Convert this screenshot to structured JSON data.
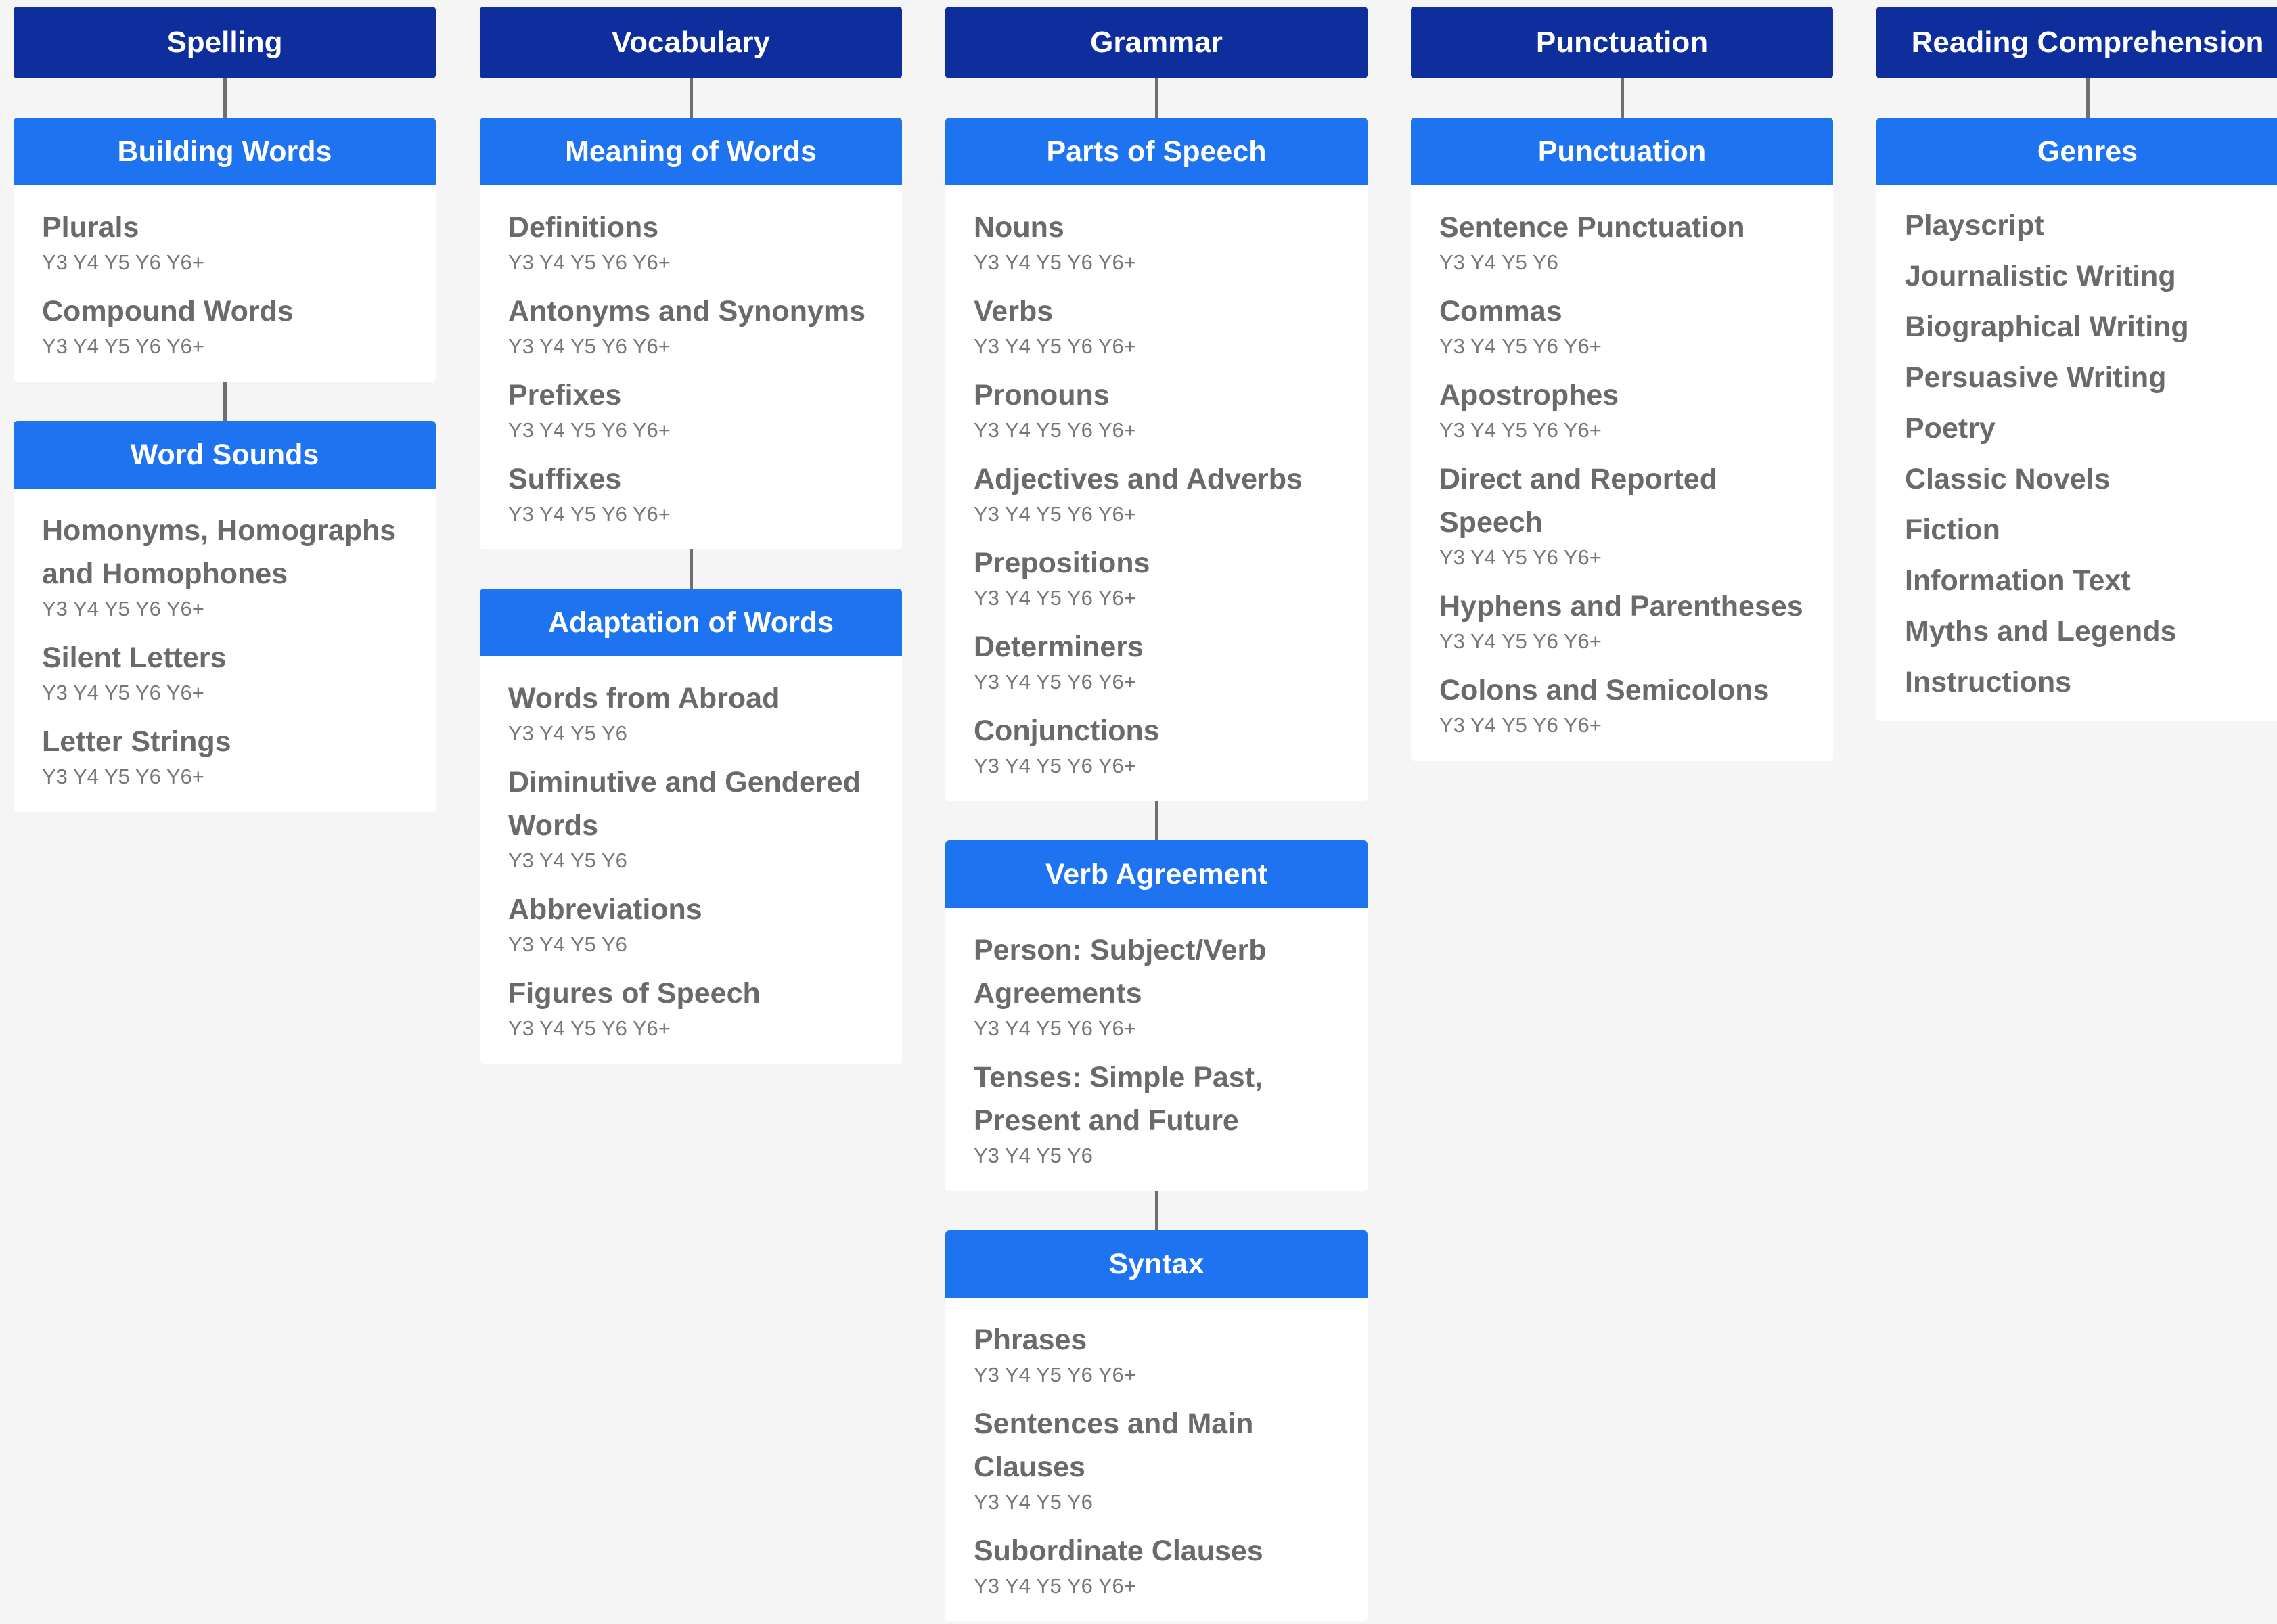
{
  "columns": [
    {
      "category": "Spelling",
      "groups": [
        {
          "title": "Building Words",
          "topics": [
            {
              "name": "Plurals",
              "years": "Y3 Y4 Y5 Y6 Y6+"
            },
            {
              "name": "Compound Words",
              "years": "Y3 Y4 Y5 Y6 Y6+"
            }
          ]
        },
        {
          "title": "Word Sounds",
          "topics": [
            {
              "name": "Homonyms, Homographs and Homophones",
              "years": "Y3 Y4 Y5 Y6 Y6+"
            },
            {
              "name": "Silent Letters",
              "years": "Y3 Y4 Y5 Y6 Y6+"
            },
            {
              "name": "Letter Strings",
              "years": "Y3 Y4 Y5 Y6 Y6+"
            }
          ]
        }
      ]
    },
    {
      "category": "Vocabulary",
      "groups": [
        {
          "title": "Meaning of Words",
          "topics": [
            {
              "name": "Definitions",
              "years": "Y3 Y4 Y5 Y6 Y6+"
            },
            {
              "name": "Antonyms and Synonyms",
              "years": "Y3 Y4 Y5 Y6 Y6+"
            },
            {
              "name": "Prefixes",
              "years": "Y3 Y4 Y5 Y6 Y6+"
            },
            {
              "name": "Suffixes",
              "years": "Y3 Y4 Y5 Y6 Y6+"
            }
          ]
        },
        {
          "title": "Adaptation of Words",
          "topics": [
            {
              "name": "Words from Abroad",
              "years": "Y3 Y4 Y5 Y6"
            },
            {
              "name": "Diminutive and Gendered Words",
              "years": "Y3 Y4 Y5 Y6"
            },
            {
              "name": "Abbreviations",
              "years": "Y3 Y4 Y5 Y6"
            },
            {
              "name": "Figures of Speech",
              "years": "Y3 Y4 Y5 Y6 Y6+"
            }
          ]
        }
      ]
    },
    {
      "category": "Grammar",
      "groups": [
        {
          "title": "Parts of Speech",
          "topics": [
            {
              "name": "Nouns",
              "years": "Y3 Y4 Y5 Y6 Y6+"
            },
            {
              "name": "Verbs",
              "years": "Y3 Y4 Y5 Y6 Y6+"
            },
            {
              "name": "Pronouns",
              "years": "Y3 Y4 Y5 Y6 Y6+"
            },
            {
              "name": "Adjectives and Adverbs",
              "years": "Y3 Y4 Y5 Y6 Y6+"
            },
            {
              "name": "Prepositions",
              "years": "Y3 Y4 Y5 Y6 Y6+"
            },
            {
              "name": "Determiners",
              "years": "Y3 Y4 Y5 Y6 Y6+"
            },
            {
              "name": "Conjunctions",
              "years": "Y3 Y4 Y5 Y6 Y6+"
            }
          ]
        },
        {
          "title": "Verb Agreement",
          "topics": [
            {
              "name": "Person: Subject/Verb Agreements",
              "years": "Y3 Y4 Y5 Y6 Y6+"
            },
            {
              "name": "Tenses: Simple Past, Present and Future",
              "years": "Y3 Y4 Y5 Y6"
            }
          ]
        },
        {
          "title": "Syntax",
          "topics": [
            {
              "name": "Phrases",
              "years": "Y3 Y4 Y5 Y6 Y6+"
            },
            {
              "name": "Sentences and Main Clauses",
              "years": "Y3 Y4 Y5 Y6"
            },
            {
              "name": "Subordinate Clauses",
              "years": "Y3 Y4 Y5 Y6 Y6+"
            }
          ]
        }
      ]
    },
    {
      "category": "Punctuation",
      "groups": [
        {
          "title": "Punctuation",
          "topics": [
            {
              "name": "Sentence Punctuation",
              "years": "Y3 Y4 Y5 Y6"
            },
            {
              "name": "Commas",
              "years": "Y3 Y4 Y5 Y6 Y6+"
            },
            {
              "name": "Apostrophes",
              "years": "Y3 Y4 Y5 Y6 Y6+"
            },
            {
              "name": "Direct and Reported Speech",
              "years": "Y3 Y4 Y5 Y6 Y6+"
            },
            {
              "name": "Hyphens and Parentheses",
              "years": "Y3 Y4 Y5 Y6 Y6+"
            },
            {
              "name": "Colons and Semicolons",
              "years": "Y3 Y4 Y5 Y6 Y6+"
            }
          ]
        }
      ]
    },
    {
      "category": "Reading Comprehension",
      "groups": [
        {
          "title": "Genres",
          "topics": [
            {
              "name": "Playscript"
            },
            {
              "name": "Journalistic Writing"
            },
            {
              "name": "Biographical Writing"
            },
            {
              "name": "Persuasive Writing"
            },
            {
              "name": "Poetry"
            },
            {
              "name": "Classic Novels"
            },
            {
              "name": "Fiction"
            },
            {
              "name": "Information Text"
            },
            {
              "name": "Myths and Legends"
            },
            {
              "name": "Instructions"
            }
          ]
        }
      ]
    }
  ]
}
